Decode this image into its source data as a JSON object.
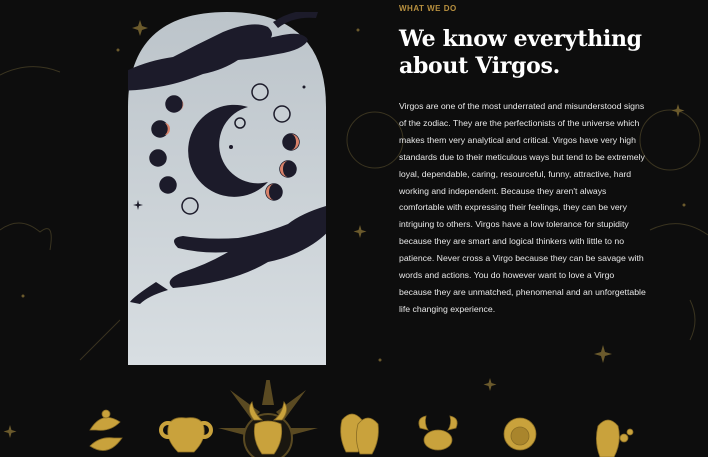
{
  "section": {
    "eyebrow": "WHAT WE DO",
    "heading_line1": "We know everything",
    "heading_line2": "about Virgos.",
    "body": "Virgos are one of the most underrated and misunderstood signs of the zodiac. They are the perfectionists of the universe which makes them very analytical and critical. Virgos have very high standards due to their meticulous ways but tend to be extremely loyal, dependable, caring, resourceful, funny, attractive, hard working and independent. Because they aren't always comfortable with expressing their feelings, they can be very intriguing to others. Virgos have a low tolerance for stupidity because they are smart and logical thinkers with little to no patience. Never cross a Virgo because they can be savage with words and actions. You do however want to love a Virgo because they are unmatched, phenomenal and an unforgettable life changing experience."
  },
  "illustration": {
    "icon": "hands-moon-phases-icon"
  },
  "zodiac_icons": [
    "pisces-icon",
    "aries-icon",
    "taurus-icon",
    "gemini-icon",
    "cancer-icon",
    "leo-icon",
    "virgo-icon"
  ],
  "colors": {
    "background": "#0d0d0d",
    "gold": "#b8903f",
    "panel": "#c8cfd4",
    "ink": "#1c1b2a",
    "accent": "#d9826a"
  }
}
